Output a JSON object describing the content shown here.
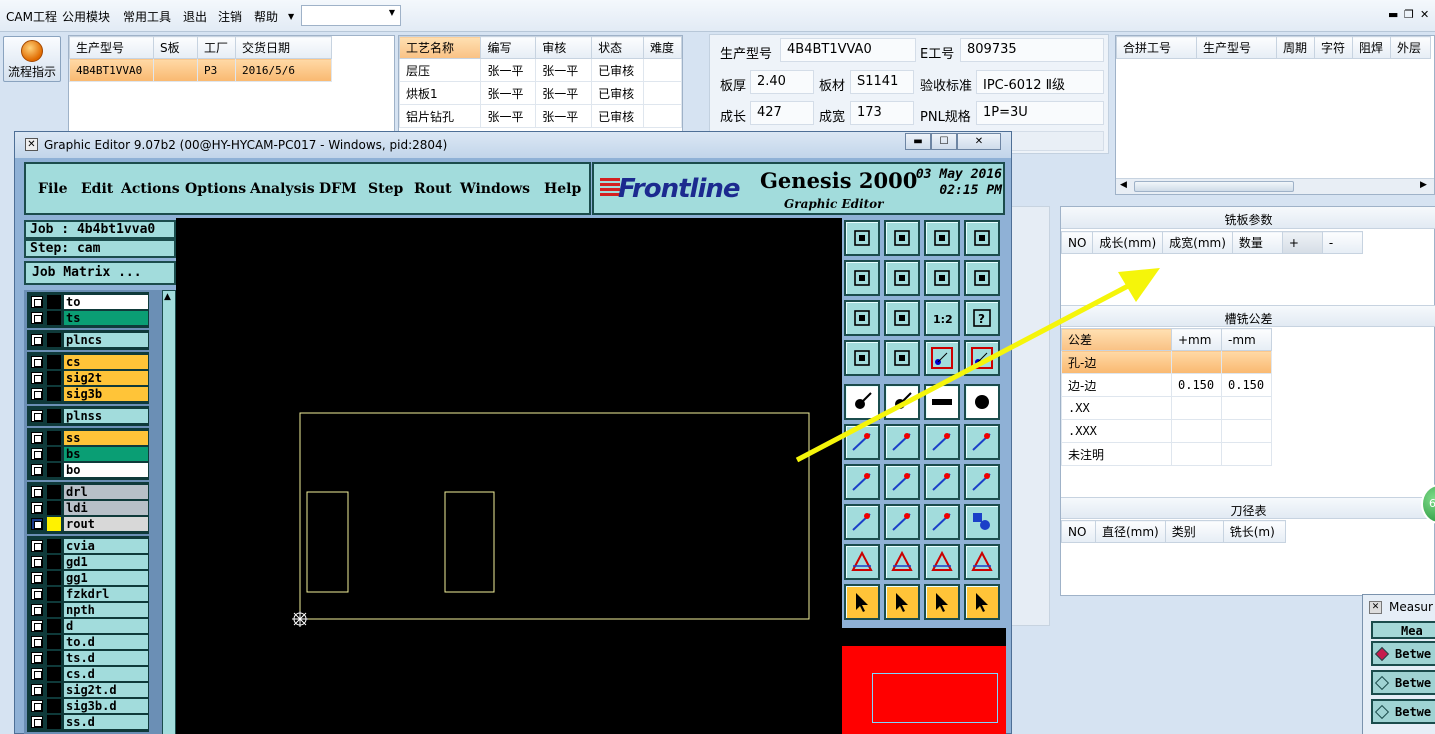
{
  "menubar": {
    "items": [
      "CAM工程",
      "公用模块",
      "常用工具",
      "退出",
      "注销",
      "帮助"
    ],
    "combo_value": ""
  },
  "flow_button": {
    "label": "流程指示"
  },
  "order_table": {
    "headers": [
      "生产型号",
      "S板",
      "工厂",
      "交货日期"
    ],
    "rows": [
      [
        "4B4BT1VVA0",
        "",
        "P3",
        "2016/5/6"
      ]
    ]
  },
  "process_table": {
    "headers": [
      "工艺名称",
      "编写",
      "审核",
      "状态",
      "难度"
    ],
    "rows": [
      [
        "层压",
        "张一平",
        "张一平",
        "已审核",
        ""
      ],
      [
        "烘板1",
        "张一平",
        "张一平",
        "已审核",
        ""
      ],
      [
        "铝片钻孔",
        "张一平",
        "张一平",
        "已审核",
        ""
      ]
    ]
  },
  "info": {
    "model_label": "生产型号",
    "model_value": "4B4BT1VVA0",
    "eno_label": "E工号",
    "eno_value": "809735",
    "thickness_label": "板厚",
    "thickness_value": "2.40",
    "material_label": "板材",
    "material_value": "S1141",
    "standard_label": "验收标准",
    "standard_value": "IPC-6012 Ⅱ级",
    "length_label": "成长",
    "length_value": "427",
    "width_label": "成宽",
    "width_value": "173",
    "pnl_label": "PNL规格",
    "pnl_value": "1P=3U"
  },
  "merge_table": {
    "headers": [
      "合拼工号",
      "生产型号",
      "周期",
      "字符",
      "阻焊",
      "外层"
    ]
  },
  "milling_params": {
    "title": "铣板参数",
    "headers": [
      "NO",
      "成长(mm)",
      "成宽(mm)",
      "数量",
      "+",
      "-"
    ]
  },
  "slot_tolerance": {
    "title": "槽铣公差",
    "headers": [
      "公差",
      "+mm",
      "-mm"
    ],
    "rows": [
      [
        "孔-边",
        "",
        ""
      ],
      [
        "边-边",
        "0.150",
        "0.150"
      ],
      [
        ".XX",
        "",
        ""
      ],
      [
        ".XXX",
        "",
        ""
      ],
      [
        "未注明",
        "",
        ""
      ]
    ]
  },
  "tool_table": {
    "title": "刀径表",
    "headers": [
      "NO",
      "直径(mm)",
      "类别",
      "铣长(m)"
    ]
  },
  "green_badge": "6",
  "measure": {
    "title": "Measur",
    "header": "Mea",
    "buttons": [
      "Betwe",
      "Betwe",
      "Betwe"
    ]
  },
  "graphic_editor": {
    "title": "Graphic Editor 9.07b2 (00@HY-HYCAM-PC017 - Windows, pid:2804)",
    "menus": [
      "File",
      "Edit",
      "Actions",
      "Options",
      "Analysis",
      "DFM",
      "Step",
      "Rout",
      "Windows",
      "Help"
    ],
    "logo": "Frontline",
    "product": "Genesis 2000",
    "subtitle": "Graphic Editor",
    "date_line1": "03 May 2016",
    "date_line2": "02:15 PM",
    "job": "Job : 4b4bt1vva0",
    "step": "Step: cam",
    "job_matrix": "Job Matrix ...",
    "layers": [
      {
        "name": "to",
        "color": "#ffffff"
      },
      {
        "name": "ts",
        "color": "#0a9e74"
      },
      {
        "name": "plncs",
        "color": "#a2dcdc"
      },
      {
        "name": "cs",
        "color": "#ffc438"
      },
      {
        "name": "sig2t",
        "color": "#ffc438"
      },
      {
        "name": "sig3b",
        "color": "#ffc438"
      },
      {
        "name": "plnss",
        "color": "#a2dcdc"
      },
      {
        "name": "ss",
        "color": "#ffc438"
      },
      {
        "name": "bs",
        "color": "#0a9e74"
      },
      {
        "name": "bo",
        "color": "#ffffff"
      },
      {
        "name": "drl",
        "color": "#b8c0c8"
      },
      {
        "name": "ldi",
        "color": "#b8c0c8"
      },
      {
        "name": "rout",
        "color": "#d8d8d8"
      },
      {
        "name": "cvia",
        "color": "#a2dcdc"
      },
      {
        "name": "gd1",
        "color": "#a2dcdc"
      },
      {
        "name": "gg1",
        "color": "#a2dcdc"
      },
      {
        "name": "fzkdrl",
        "color": "#a2dcdc"
      },
      {
        "name": "npth",
        "color": "#a2dcdc"
      },
      {
        "name": "d",
        "color": "#a2dcdc"
      },
      {
        "name": "to.d",
        "color": "#a2dcdc"
      },
      {
        "name": "ts.d",
        "color": "#a2dcdc"
      },
      {
        "name": "cs.d",
        "color": "#a2dcdc"
      },
      {
        "name": "sig2t.d",
        "color": "#a2dcdc"
      },
      {
        "name": "sig3b.d",
        "color": "#a2dcdc"
      },
      {
        "name": "ss.d",
        "color": "#a2dcdc"
      }
    ]
  }
}
